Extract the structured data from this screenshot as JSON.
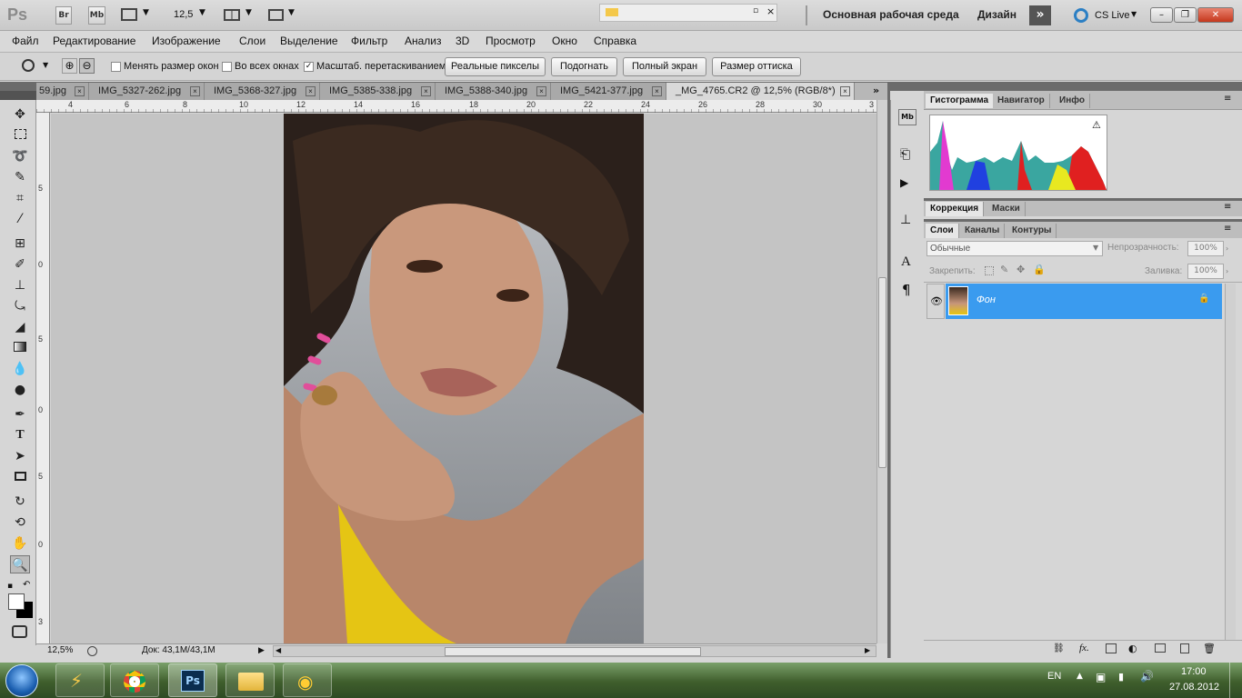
{
  "app": {
    "logo": "Ps",
    "zoom": "12,5"
  },
  "app_buttons": {
    "bridge": "Br",
    "mini_bridge": "Mb"
  },
  "workspace": {
    "label": "Основная рабочая среда",
    "design": "Дизайн",
    "cs_live": "CS Live"
  },
  "menu": [
    "Файл",
    "Редактирование",
    "Изображение",
    "Слои",
    "Выделение",
    "Фильтр",
    "Анализ",
    "3D",
    "Просмотр",
    "Окно",
    "Справка"
  ],
  "options": {
    "checkboxes": [
      {
        "label": "Менять размер окон",
        "checked": false
      },
      {
        "label": "Во всех окнах",
        "checked": false
      },
      {
        "label": "Масштаб. перетаскиванием",
        "checked": true
      }
    ],
    "buttons": [
      "Реальные пикселы",
      "Подогнать",
      "Полный экран",
      "Размер оттиска"
    ]
  },
  "tabs": [
    {
      "label": "59.jpg",
      "active": false
    },
    {
      "label": "IMG_5327-262.jpg",
      "active": false
    },
    {
      "label": "IMG_5368-327.jpg",
      "active": false
    },
    {
      "label": "IMG_5385-338.jpg",
      "active": false
    },
    {
      "label": "IMG_5388-340.jpg",
      "active": false
    },
    {
      "label": "IMG_5421-377.jpg",
      "active": false
    },
    {
      "label": "_MG_4765.CR2 @ 12,5% (RGB/8*)",
      "active": true
    }
  ],
  "ruler": {
    "h": [
      "4",
      "6",
      "8",
      "10",
      "12",
      "14",
      "16",
      "18",
      "20",
      "22",
      "24",
      "26",
      "28",
      "30",
      "3"
    ],
    "v": [
      "5",
      "0",
      "5",
      "0",
      "5",
      "0",
      "3"
    ]
  },
  "status": {
    "zoom": "12,5%",
    "doc": "Док: 43,1M/43,1M"
  },
  "panels": {
    "top_tabs": [
      "Гистограмма",
      "Навигатор",
      "Инфо"
    ],
    "mid_tabs": [
      "Коррекция",
      "Маски"
    ],
    "layer_tabs": [
      "Слои",
      "Каналы",
      "Контуры"
    ],
    "blend_mode": "Обычные",
    "opacity_label": "Непрозрачность:",
    "opacity_value": "100%",
    "lock_label": "Закрепить:",
    "fill_label": "Заливка:",
    "fill_value": "100%",
    "layer_name": "Фон"
  },
  "taskbar": {
    "lang": "EN",
    "time": "17:00",
    "date": "27.08.2012"
  },
  "colors": {
    "accent": "#3a9bef",
    "ui_gray": "#d6d6d6",
    "canvas_gray": "#c4c4c4"
  }
}
